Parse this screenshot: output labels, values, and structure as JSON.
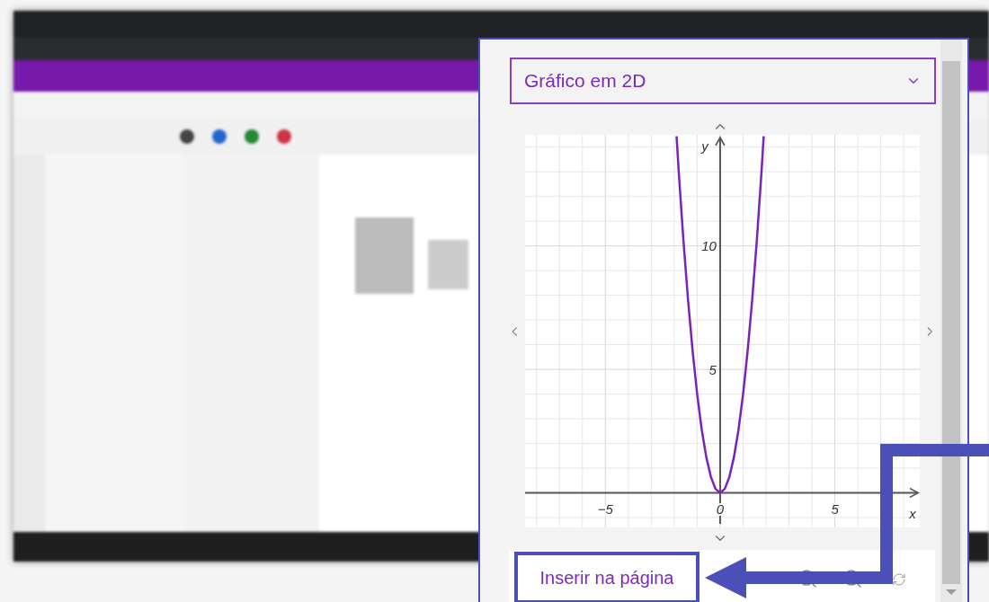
{
  "dropdown": {
    "value": "Gráfico em 2D"
  },
  "graph": {
    "chart_data": {
      "type": "line",
      "grid": true,
      "xlabel": "x",
      "ylabel": "y",
      "xlim": [
        -8.5,
        8.7
      ],
      "ylim": [
        -1.4,
        14.5
      ],
      "xticks": [
        {
          "value": -5,
          "label": "−5"
        },
        0,
        5
      ],
      "yticks": [
        5,
        10
      ],
      "x": [
        -1.9,
        -1.8,
        -1.6,
        -1.4,
        -1.2,
        -1,
        -0.8,
        -0.6,
        -0.4,
        -0.2,
        0,
        0.2,
        0.4,
        0.6,
        0.8,
        1,
        1.2,
        1.4,
        1.6,
        1.8,
        1.9
      ],
      "series": [
        {
          "color": "#7b22b8",
          "values": [
            14.44,
            12.96,
            10.24,
            7.84,
            5.76,
            4,
            2.56,
            1.44,
            0.64,
            0.16,
            0,
            0.16,
            0.64,
            1.44,
            2.56,
            4,
            5.76,
            7.84,
            10.24,
            12.96,
            14.44
          ]
        }
      ]
    }
  },
  "insert_button": {
    "label": "Inserir na página"
  }
}
